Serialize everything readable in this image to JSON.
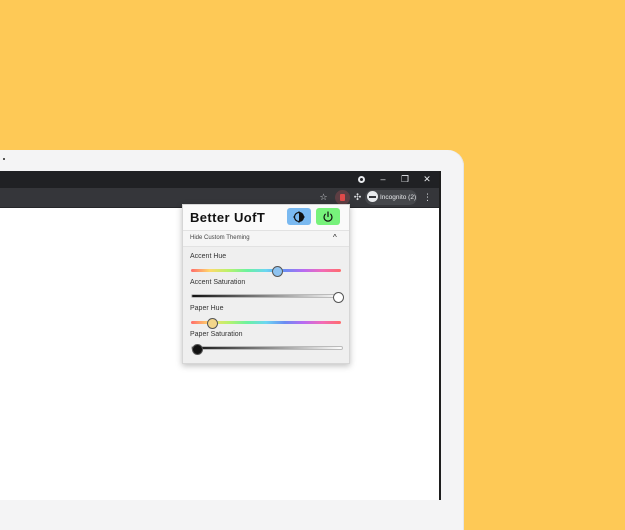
{
  "colors": {
    "background": "#fec956",
    "accent_thumb": "#8ec3f0",
    "paper_thumb": "#f3d68a",
    "theme_button": "#7ab9f0",
    "power_button": "#77f27b"
  },
  "window": {
    "controls": [
      "minimize-icon",
      "restore-icon",
      "close-icon"
    ],
    "min_label": "–",
    "restore_label": "❐",
    "close_label": "✕"
  },
  "toolbar": {
    "star_icon": "☆",
    "puzzle_icon": "✣",
    "menu_icon": "⋮",
    "incognito_label": "Incognito (2)"
  },
  "popup": {
    "title": "Better UofT",
    "theme_button_icon": "theme-icon",
    "power_button_icon": "power-icon",
    "section_label": "Hide Custom Theming",
    "section_chevron": "^",
    "sliders": [
      {
        "label": "Accent Hue",
        "value": 0.57
      },
      {
        "label": "Accent Saturation",
        "value": 0.97
      },
      {
        "label": "Paper Hue",
        "value": 0.14
      },
      {
        "label": "Paper Saturation",
        "value": 0.03
      }
    ]
  }
}
